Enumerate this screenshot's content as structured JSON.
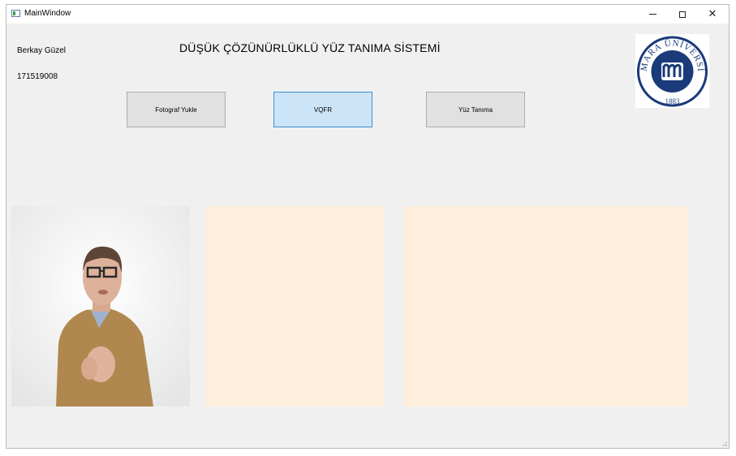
{
  "window": {
    "title": "MainWindow",
    "controls": {
      "minimize": "–",
      "maximize": "☐",
      "close": "✕"
    }
  },
  "info": {
    "author": "Berkay Güzel",
    "student_no": "171519008",
    "title": "DÜŞÜK ÇÖZÜNÜRLÜKLÜ YÜZ TANIMA SİSTEMİ"
  },
  "buttons": {
    "upload": "Fotograf Yukle",
    "vqfr": "VQFR",
    "face": "Yüz Tanıma"
  },
  "logo": {
    "text": "MARMARA ÜNİVERSİTESİ",
    "year": "1883",
    "color": "#1a3a7a"
  },
  "colors": {
    "panel": "#fdefdc",
    "window_bg": "#f0f0f0",
    "vqfr_button": "#cce4f7"
  }
}
